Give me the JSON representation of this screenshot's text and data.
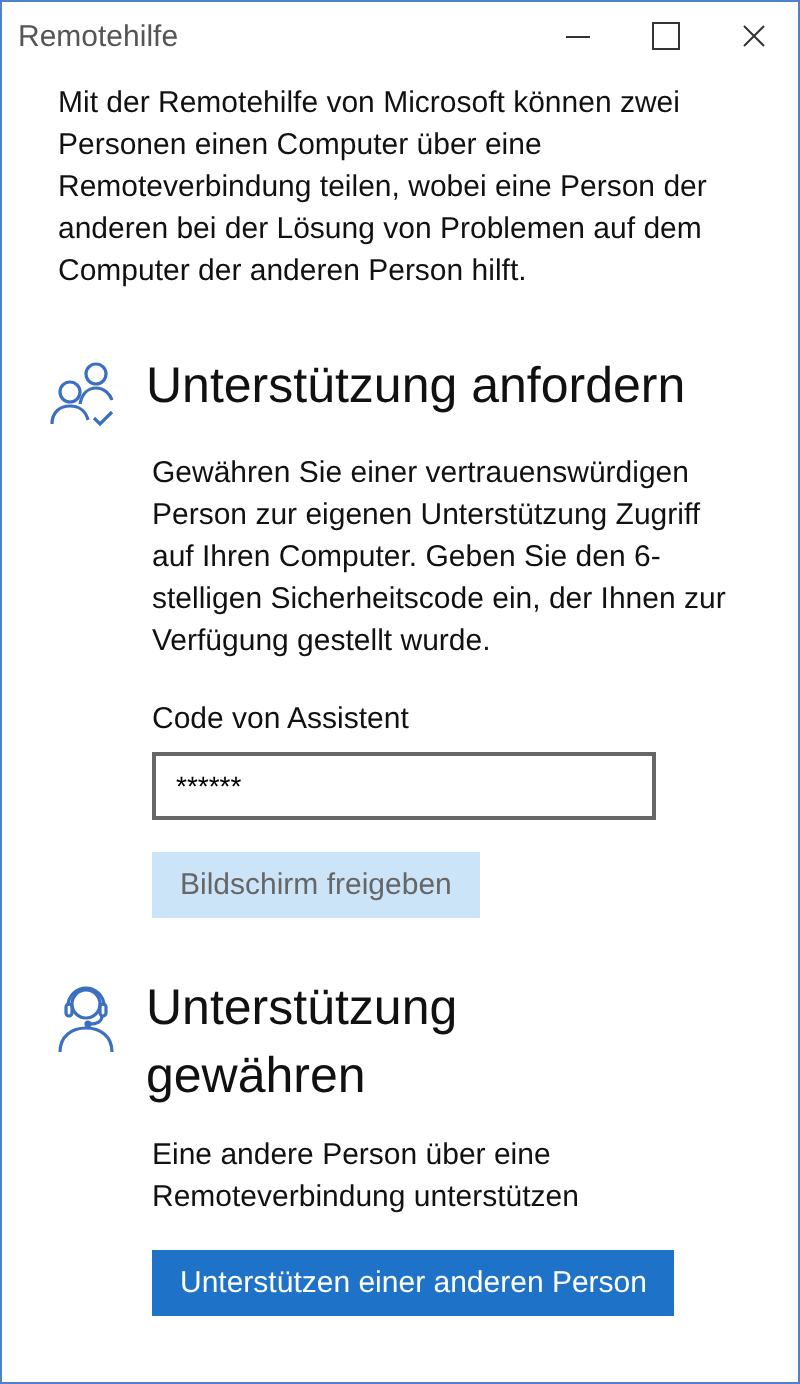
{
  "window": {
    "title": "Remotehilfe"
  },
  "intro": "Mit der Remotehilfe von Microsoft können zwei Personen einen Computer über eine Remoteverbindung teilen, wobei eine Person der anderen bei der Lösung von Problemen auf dem Computer der anderen Person hilft.",
  "sections": [
    {
      "kind": "request",
      "heading": "Unterstützung anfordern",
      "text": "Gewähren Sie einer vertrauenswürdigen Person zur eigenen Unterstützung Zugriff auf Ihren Computer. Geben Sie den 6-stelligen Sicherheitscode ein, der Ihnen zur Verfügung gestellt wurde.",
      "field": {
        "label": "Code von Assistent",
        "value": "******"
      },
      "button": {
        "label": "Bildschirm freigeben",
        "disabled": true
      }
    },
    {
      "kind": "give",
      "heading": "Unterstützung gewähren",
      "text": "Eine andere Person über eine Remoteverbindung unterstützen",
      "button": {
        "label": "Unterstützen einer anderen Person",
        "disabled": false
      }
    }
  ]
}
